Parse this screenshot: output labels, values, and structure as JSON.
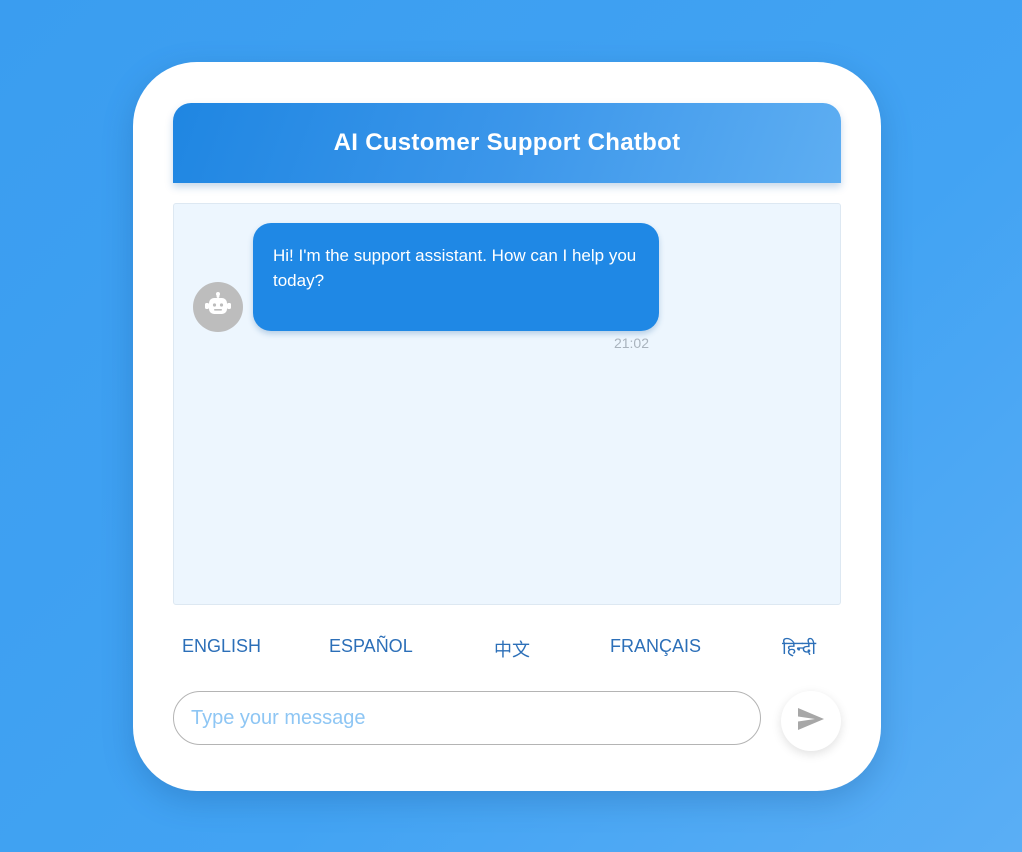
{
  "header": {
    "title": "AI Customer Support Chatbot"
  },
  "chat": {
    "messages": [
      {
        "sender": "bot",
        "avatar_icon": "robot-icon",
        "text": "Hi! I'm the support assistant. How can I help you today?",
        "time": "21:02"
      }
    ]
  },
  "languages": [
    {
      "label": "ENGLISH"
    },
    {
      "label": "ESPAÑOL"
    },
    {
      "label": "中文"
    },
    {
      "label": "FRANÇAIS"
    },
    {
      "label": "हिन्दी"
    }
  ],
  "composer": {
    "placeholder": "Type your message",
    "value": "",
    "send_icon": "send-icon"
  },
  "colors": {
    "accent": "#1f88e5",
    "background": "#3a9df0",
    "chat_background": "#edf6fe",
    "language_text": "#2c6fb8"
  }
}
